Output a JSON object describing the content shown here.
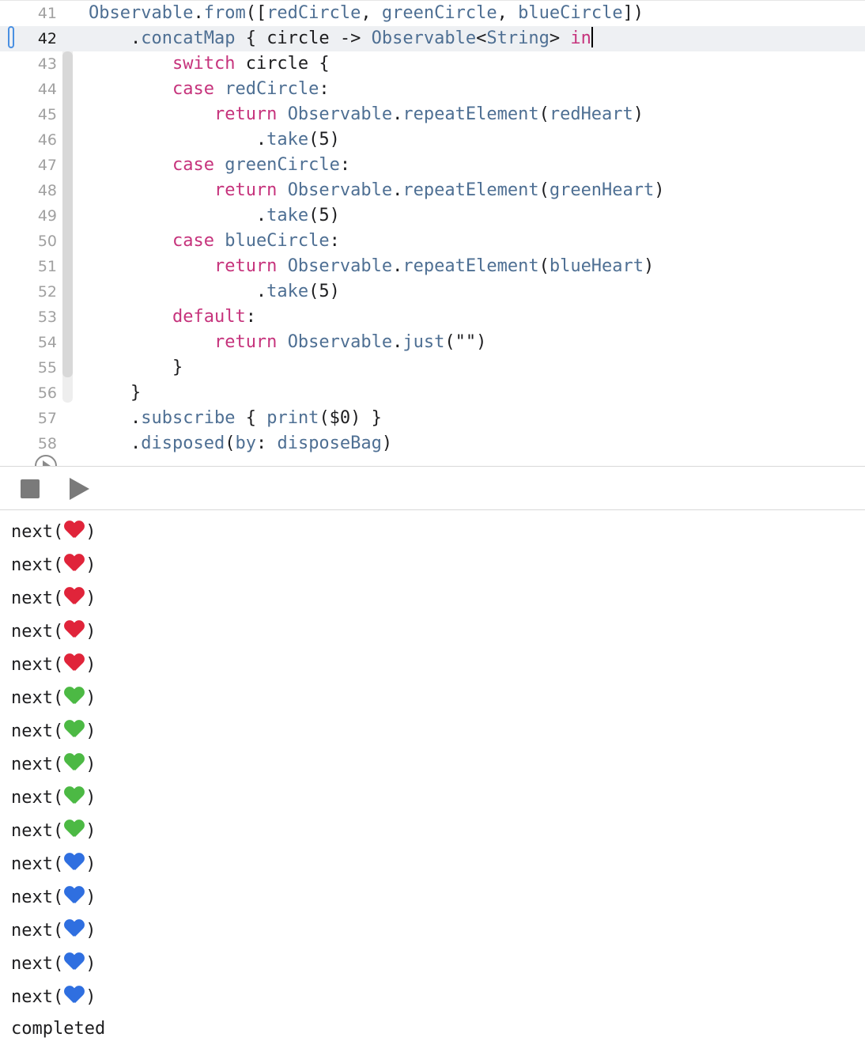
{
  "editor": {
    "current_line": "42",
    "lines": [
      {
        "number": "41",
        "tokens": [
          {
            "text": "Observable",
            "c": "type"
          },
          {
            "text": ".",
            "c": "pl"
          },
          {
            "text": "from",
            "c": "id"
          },
          {
            "text": "([",
            "c": "pl"
          },
          {
            "text": "redCircle",
            "c": "id"
          },
          {
            "text": ", ",
            "c": "pl"
          },
          {
            "text": "greenCircle",
            "c": "id"
          },
          {
            "text": ", ",
            "c": "pl"
          },
          {
            "text": "blueCircle",
            "c": "id"
          },
          {
            "text": "])",
            "c": "pl"
          }
        ]
      },
      {
        "number": "42",
        "tokens": [
          {
            "text": "    .",
            "c": "pl"
          },
          {
            "text": "concatMap",
            "c": "id"
          },
          {
            "text": " { circle -> ",
            "c": "pl"
          },
          {
            "text": "Observable",
            "c": "type"
          },
          {
            "text": "<",
            "c": "pl"
          },
          {
            "text": "String",
            "c": "type"
          },
          {
            "text": "> ",
            "c": "pl"
          },
          {
            "text": "in",
            "c": "kw"
          }
        ]
      },
      {
        "number": "43",
        "tokens": [
          {
            "text": "        ",
            "c": "pl"
          },
          {
            "text": "switch",
            "c": "kw"
          },
          {
            "text": " circle {",
            "c": "pl"
          }
        ]
      },
      {
        "number": "44",
        "tokens": [
          {
            "text": "        ",
            "c": "pl"
          },
          {
            "text": "case",
            "c": "kw"
          },
          {
            "text": " ",
            "c": "pl"
          },
          {
            "text": "redCircle",
            "c": "id"
          },
          {
            "text": ":",
            "c": "pl"
          }
        ]
      },
      {
        "number": "45",
        "tokens": [
          {
            "text": "            ",
            "c": "pl"
          },
          {
            "text": "return",
            "c": "kw"
          },
          {
            "text": " ",
            "c": "pl"
          },
          {
            "text": "Observable",
            "c": "type"
          },
          {
            "text": ".",
            "c": "pl"
          },
          {
            "text": "repeatElement",
            "c": "id"
          },
          {
            "text": "(",
            "c": "pl"
          },
          {
            "text": "redHeart",
            "c": "id"
          },
          {
            "text": ")",
            "c": "pl"
          }
        ]
      },
      {
        "number": "46",
        "tokens": [
          {
            "text": "                .",
            "c": "pl"
          },
          {
            "text": "take",
            "c": "id"
          },
          {
            "text": "(5)",
            "c": "pl"
          }
        ]
      },
      {
        "number": "47",
        "tokens": [
          {
            "text": "        ",
            "c": "pl"
          },
          {
            "text": "case",
            "c": "kw"
          },
          {
            "text": " ",
            "c": "pl"
          },
          {
            "text": "greenCircle",
            "c": "id"
          },
          {
            "text": ":",
            "c": "pl"
          }
        ]
      },
      {
        "number": "48",
        "tokens": [
          {
            "text": "            ",
            "c": "pl"
          },
          {
            "text": "return",
            "c": "kw"
          },
          {
            "text": " ",
            "c": "pl"
          },
          {
            "text": "Observable",
            "c": "type"
          },
          {
            "text": ".",
            "c": "pl"
          },
          {
            "text": "repeatElement",
            "c": "id"
          },
          {
            "text": "(",
            "c": "pl"
          },
          {
            "text": "greenHeart",
            "c": "id"
          },
          {
            "text": ")",
            "c": "pl"
          }
        ]
      },
      {
        "number": "49",
        "tokens": [
          {
            "text": "                .",
            "c": "pl"
          },
          {
            "text": "take",
            "c": "id"
          },
          {
            "text": "(5)",
            "c": "pl"
          }
        ]
      },
      {
        "number": "50",
        "tokens": [
          {
            "text": "        ",
            "c": "pl"
          },
          {
            "text": "case",
            "c": "kw"
          },
          {
            "text": " ",
            "c": "pl"
          },
          {
            "text": "blueCircle",
            "c": "id"
          },
          {
            "text": ":",
            "c": "pl"
          }
        ]
      },
      {
        "number": "51",
        "tokens": [
          {
            "text": "            ",
            "c": "pl"
          },
          {
            "text": "return",
            "c": "kw"
          },
          {
            "text": " ",
            "c": "pl"
          },
          {
            "text": "Observable",
            "c": "type"
          },
          {
            "text": ".",
            "c": "pl"
          },
          {
            "text": "repeatElement",
            "c": "id"
          },
          {
            "text": "(",
            "c": "pl"
          },
          {
            "text": "blueHeart",
            "c": "id"
          },
          {
            "text": ")",
            "c": "pl"
          }
        ]
      },
      {
        "number": "52",
        "tokens": [
          {
            "text": "                .",
            "c": "pl"
          },
          {
            "text": "take",
            "c": "id"
          },
          {
            "text": "(5)",
            "c": "pl"
          }
        ]
      },
      {
        "number": "53",
        "tokens": [
          {
            "text": "        ",
            "c": "pl"
          },
          {
            "text": "default",
            "c": "kw"
          },
          {
            "text": ":",
            "c": "pl"
          }
        ]
      },
      {
        "number": "54",
        "tokens": [
          {
            "text": "            ",
            "c": "pl"
          },
          {
            "text": "return",
            "c": "kw"
          },
          {
            "text": " ",
            "c": "pl"
          },
          {
            "text": "Observable",
            "c": "type"
          },
          {
            "text": ".",
            "c": "pl"
          },
          {
            "text": "just",
            "c": "id"
          },
          {
            "text": "(\"\")",
            "c": "pl"
          }
        ]
      },
      {
        "number": "55",
        "tokens": [
          {
            "text": "        }",
            "c": "pl"
          }
        ]
      },
      {
        "number": "56",
        "tokens": [
          {
            "text": "    }",
            "c": "pl"
          }
        ]
      },
      {
        "number": "57",
        "tokens": [
          {
            "text": "    .",
            "c": "pl"
          },
          {
            "text": "subscribe",
            "c": "id"
          },
          {
            "text": " { ",
            "c": "pl"
          },
          {
            "text": "print",
            "c": "id"
          },
          {
            "text": "($0) }",
            "c": "pl"
          }
        ]
      },
      {
        "number": "58",
        "tokens": [
          {
            "text": "    .",
            "c": "pl"
          },
          {
            "text": "disposed",
            "c": "id"
          },
          {
            "text": "(",
            "c": "pl"
          },
          {
            "text": "by",
            "c": "id"
          },
          {
            "text": ": ",
            "c": "pl"
          },
          {
            "text": "disposeBag",
            "c": "id"
          },
          {
            "text": ")",
            "c": "pl"
          }
        ]
      }
    ]
  },
  "colors": {
    "keyword": "#c6337c",
    "identifier": "#4e6f93",
    "red_heart": "#e0243a",
    "green_heart": "#4cb944",
    "blue_heart": "#2f6fe0"
  },
  "console": {
    "prefix": "next(",
    "suffix": ")",
    "events": [
      {
        "heart": "red-heart-emoji"
      },
      {
        "heart": "red-heart-emoji"
      },
      {
        "heart": "red-heart-emoji"
      },
      {
        "heart": "red-heart-emoji"
      },
      {
        "heart": "red-heart-emoji"
      },
      {
        "heart": "green-heart-emoji"
      },
      {
        "heart": "green-heart-emoji"
      },
      {
        "heart": "green-heart-emoji"
      },
      {
        "heart": "green-heart-emoji"
      },
      {
        "heart": "green-heart-emoji"
      },
      {
        "heart": "blue-heart-emoji"
      },
      {
        "heart": "blue-heart-emoji"
      },
      {
        "heart": "blue-heart-emoji"
      },
      {
        "heart": "blue-heart-emoji"
      },
      {
        "heart": "blue-heart-emoji"
      }
    ],
    "completed": "completed"
  },
  "toolbar": {
    "stop_icon": "stop-icon",
    "play_icon": "play-icon"
  }
}
